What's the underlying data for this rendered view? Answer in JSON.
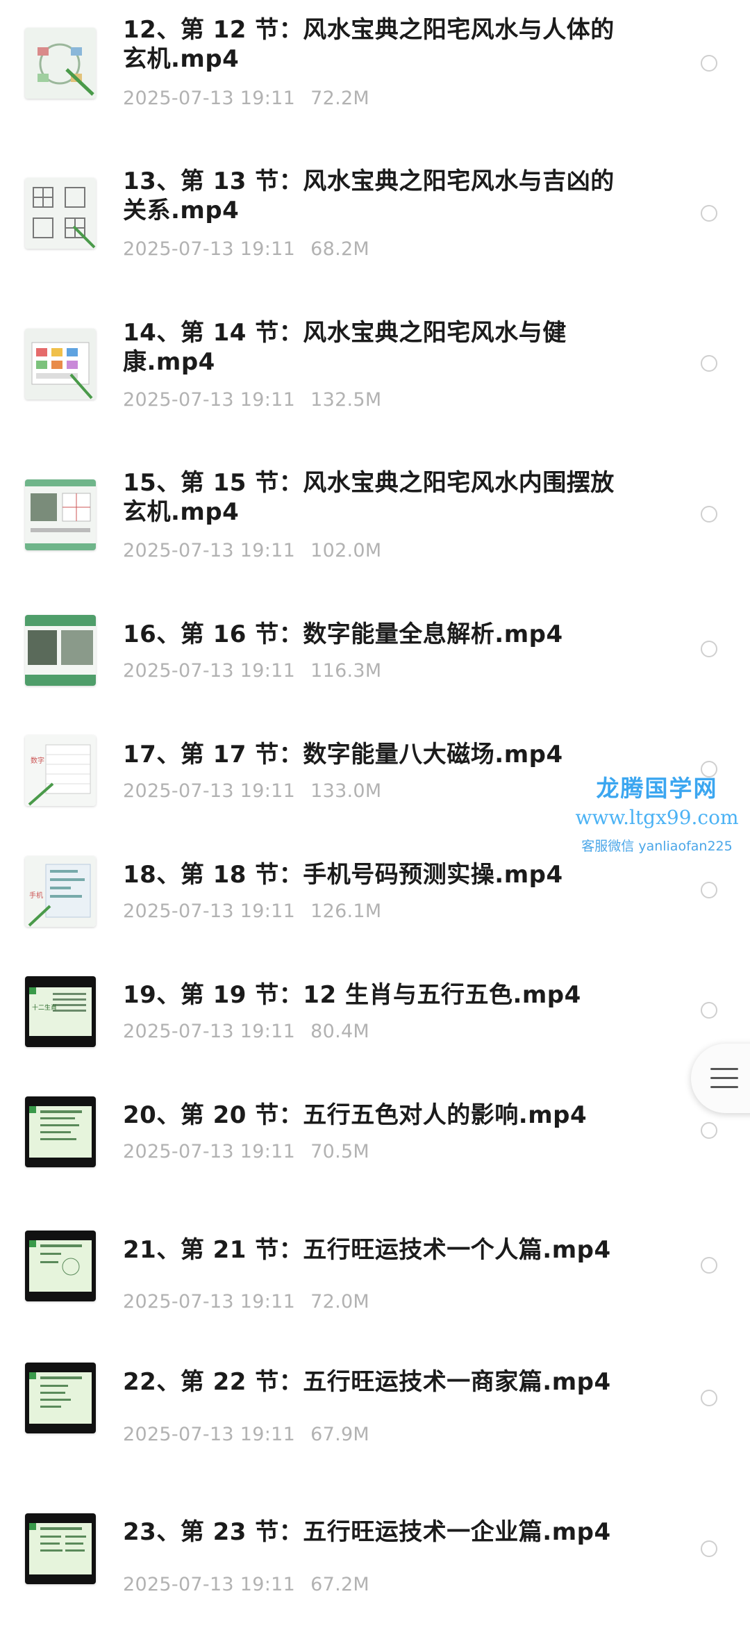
{
  "files": [
    {
      "title": "12、第 12 节：风水宝典之阳宅风水与人体的玄机.mp4",
      "date": "2025-07-13 19:11",
      "size": "72.2M"
    },
    {
      "title": "13、第 13 节：风水宝典之阳宅风水与吉凶的关系.mp4",
      "date": "2025-07-13 19:11",
      "size": "68.2M"
    },
    {
      "title": "14、第 14 节：风水宝典之阳宅风水与健康.mp4",
      "date": "2025-07-13 19:11",
      "size": "132.5M"
    },
    {
      "title": "15、第 15 节：风水宝典之阳宅风水内围摆放玄机.mp4",
      "date": "2025-07-13 19:11",
      "size": "102.0M"
    },
    {
      "title": "16、第 16 节：数字能量全息解析.mp4",
      "date": "2025-07-13 19:11",
      "size": "116.3M"
    },
    {
      "title": "17、第 17 节：数字能量八大磁场.mp4",
      "date": "2025-07-13 19:11",
      "size": "133.0M"
    },
    {
      "title": "18、第 18 节：手机号码预测实操.mp4",
      "date": "2025-07-13 19:11",
      "size": "126.1M"
    },
    {
      "title": "19、第 19 节：12 生肖与五行五色.mp4",
      "date": "2025-07-13 19:11",
      "size": "80.4M"
    },
    {
      "title": "20、第 20 节：五行五色对人的影响.mp4",
      "date": "2025-07-13 19:11",
      "size": "70.5M"
    },
    {
      "title": "21、第 21 节：五行旺运技术一个人篇.mp4",
      "date": "2025-07-13 19:11",
      "size": "72.0M"
    },
    {
      "title": "22、第 22 节：五行旺运技术一商家篇.mp4",
      "date": "2025-07-13 19:11",
      "size": "67.9M"
    },
    {
      "title": "23、第 23 节：五行旺运技术一企业篇.mp4",
      "date": "2025-07-13 19:11",
      "size": "67.2M"
    }
  ],
  "watermark": {
    "name": "龙腾国学网",
    "url": "www.ltgx99.com",
    "contact": "客服微信 yanliaofan225"
  },
  "icons": {
    "thumbnail": "video-thumbnail-icon",
    "select": "radio-circle-icon",
    "menu": "hamburger-menu-icon"
  }
}
